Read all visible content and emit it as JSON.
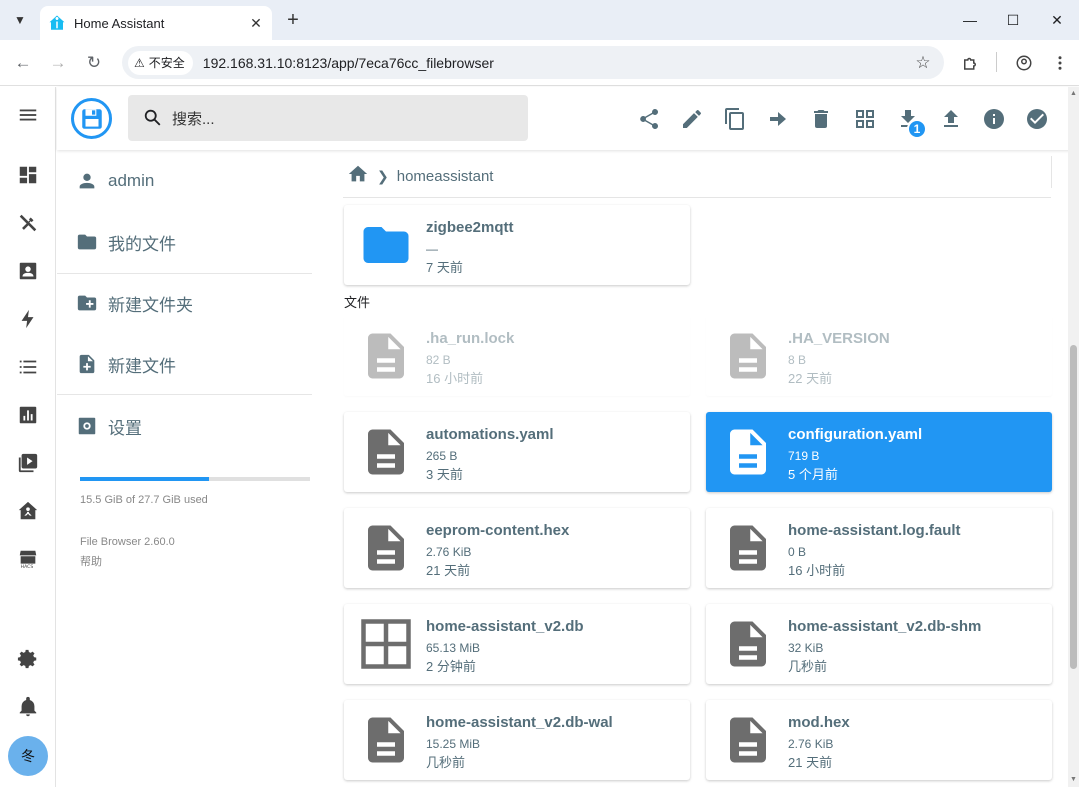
{
  "browser": {
    "tab_title": "Home Assistant",
    "security_label": "不安全",
    "url": "192.168.31.10:8123/app/7eca76cc_filebrowser"
  },
  "header": {
    "search_placeholder": "搜索...",
    "download_badge": "1"
  },
  "user": {
    "initial": "冬"
  },
  "nav": {
    "user": "admin",
    "my_files": "我的文件",
    "new_folder": "新建文件夹",
    "new_file": "新建文件",
    "settings": "设置"
  },
  "usage": {
    "text": "15.5 GiB of 27.7 GiB used",
    "fraction": 0.56
  },
  "footer": {
    "version": "File Browser 2.60.0",
    "help": "帮助"
  },
  "breadcrumb": {
    "current": "homeassistant"
  },
  "sections": {
    "files_label": "文件"
  },
  "folders": [
    {
      "name": "zigbee2mqtt",
      "size": "—",
      "modified": "7 天前"
    }
  ],
  "files": [
    {
      "name": ".ha_run.lock",
      "size": "82 B",
      "modified": "16 小时前",
      "icon": "file-document-icon",
      "state": "hidden"
    },
    {
      "name": ".HA_VERSION",
      "size": "8 B",
      "modified": "22 天前",
      "icon": "file-document-icon",
      "state": "hidden"
    },
    {
      "name": "automations.yaml",
      "size": "265 B",
      "modified": "3 天前",
      "icon": "file-document-icon",
      "state": "normal"
    },
    {
      "name": "configuration.yaml",
      "size": "719 B",
      "modified": "5 个月前",
      "icon": "file-document-icon",
      "state": "selected"
    },
    {
      "name": "eeprom-content.hex",
      "size": "2.76 KiB",
      "modified": "21 天前",
      "icon": "file-document-icon",
      "state": "normal"
    },
    {
      "name": "home-assistant.log.fault",
      "size": "0 B",
      "modified": "16 小时前",
      "icon": "file-document-icon",
      "state": "normal"
    },
    {
      "name": "home-assistant_v2.db",
      "size": "65.13 MiB",
      "modified": "2 分钟前",
      "icon": "database-grid-icon",
      "state": "normal"
    },
    {
      "name": "home-assistant_v2.db-shm",
      "size": "32 KiB",
      "modified": "几秒前",
      "icon": "file-document-icon",
      "state": "normal"
    },
    {
      "name": "home-assistant_v2.db-wal",
      "size": "15.25 MiB",
      "modified": "几秒前",
      "icon": "file-document-icon",
      "state": "normal"
    },
    {
      "name": "mod.hex",
      "size": "2.76 KiB",
      "modified": "21 天前",
      "icon": "file-document-icon",
      "state": "normal"
    }
  ],
  "colors": {
    "accent": "#2196f3",
    "icon_grey": "#546e7a",
    "file_icon": "#6d6d6d"
  }
}
